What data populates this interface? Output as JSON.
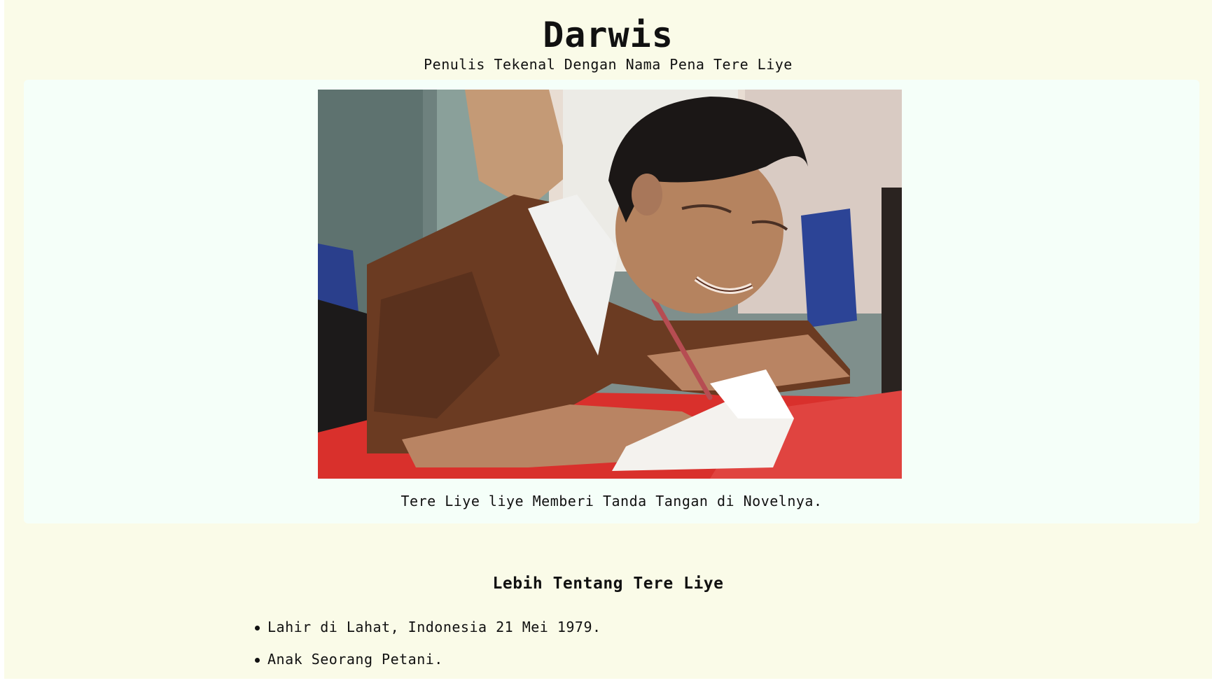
{
  "header": {
    "title": "Darwis",
    "subtitle": "Penulis Tekenal Dengan Nama Pena Tere Liye"
  },
  "figure": {
    "image_description": "Photo of a man in a brown sweater signing a book at a table",
    "caption": "Tere Liye liye Memberi Tanda Tangan di Novelnya."
  },
  "about": {
    "heading": "Lebih Tentang Tere Liye",
    "items": [
      "Lahir di Lahat, Indonesia 21 Mei 1979.",
      "Anak Seorang Petani."
    ]
  }
}
